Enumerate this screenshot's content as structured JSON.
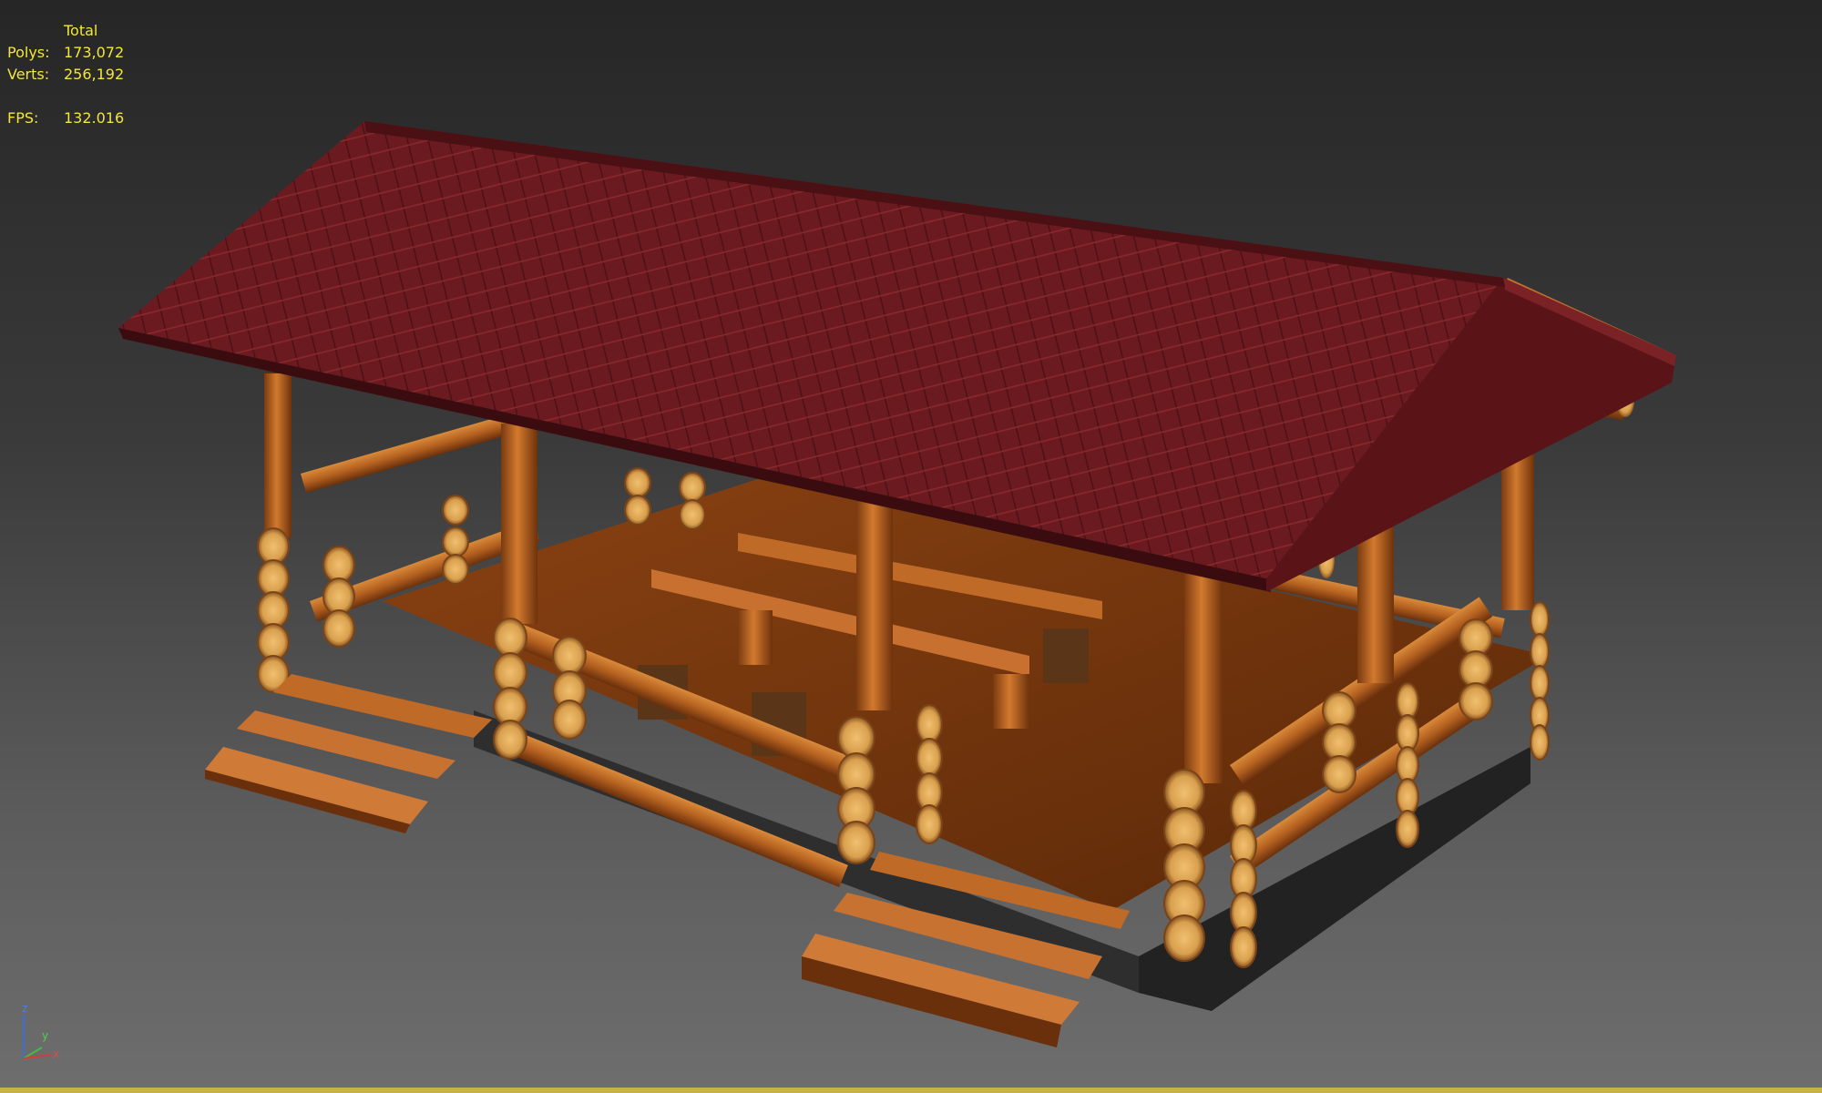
{
  "viewport": {
    "stats": {
      "header": "Total",
      "polys_label": "Polys:",
      "polys_value": "173,072",
      "verts_label": "Verts:",
      "verts_value": "256,192",
      "fps_label": "FPS:",
      "fps_value": "132.016"
    },
    "axis": {
      "z_label": "z",
      "y_label": "y",
      "x_label": "x"
    },
    "colors": {
      "stats_text": "#f2e63a",
      "roof": "#6b1a1f",
      "wood": "#a8561c",
      "foundation": "#2e2e2e"
    }
  }
}
